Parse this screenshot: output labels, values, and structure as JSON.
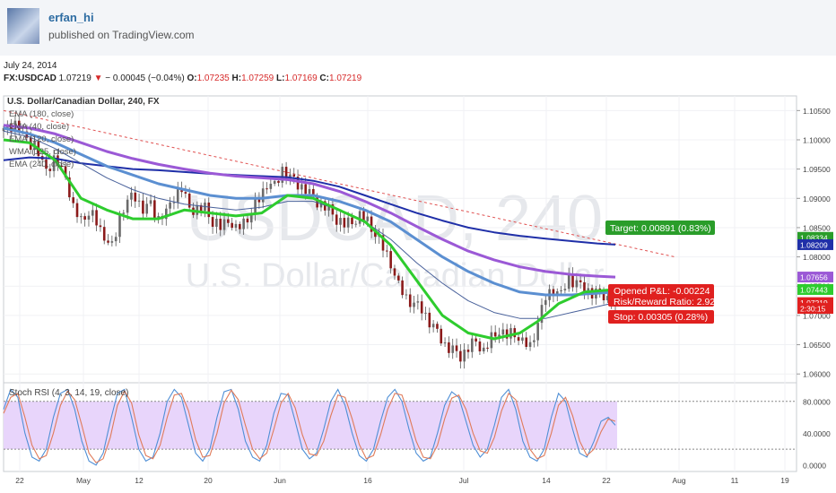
{
  "header": {
    "author": "erfan_hi",
    "published": "published on TradingView.com",
    "date": "July 24, 2014",
    "symbol": "FX:USDCAD",
    "price": "1.07219",
    "change": "− 0.00045 (−0.04%)",
    "open_label": "O:",
    "open": "1.07235",
    "high_label": "H:",
    "high": "1.07259",
    "low_label": "L:",
    "low": "1.07169",
    "close_label": "C:",
    "close": "1.07219"
  },
  "colors": {
    "green_ma": "#2ecc2e",
    "steel_ma": "#5b8fd1",
    "thin_ma": "#48609a",
    "purple_ma": "#9b59d6",
    "navy_ma": "#1f2fa8",
    "trend": "#e05050",
    "stoch_k": "#4f8fd6",
    "stoch_d": "#e07b5a",
    "stoch_band": "#e8d5fb",
    "target": "#2a9d2a",
    "stop": "#e0201f"
  },
  "chart_data": [
    {
      "type": "candlestick",
      "title": "U.S. Dollar/Canadian Dollar, 240, FX",
      "watermark_symbol": "USDCAD, 240",
      "watermark_name": "U.S. Dollar/Canadian Dollar",
      "legend": [
        "EMA (180, close)",
        "EMA (40, close)",
        "EMA (120, close)",
        "WMA (125, close)",
        "EMA (240, close)"
      ],
      "x_ticks": [
        "22",
        "May",
        "12",
        "20",
        "Jun",
        "16",
        "Jul",
        "14",
        "22",
        "Aug",
        "11",
        "19"
      ],
      "y_ticks": [
        "1.10500",
        "1.10000",
        "1.09500",
        "1.09000",
        "1.08500",
        "1.08000",
        "1.07500",
        "1.07000",
        "1.06500",
        "1.06000"
      ],
      "ylim": [
        1.0585,
        1.1075
      ],
      "price_tags": [
        {
          "label": "1.08334",
          "value": 1.08334,
          "color": "#2a9d2a"
        },
        {
          "label": "1.08209",
          "value": 1.08209,
          "color": "#1f2fa8"
        },
        {
          "label": "1.07656",
          "value": 1.07656,
          "color": "#9b59d6"
        },
        {
          "label": "1.07443",
          "value": 1.07443,
          "color": "#2ecc2e"
        },
        {
          "label": "1.07219",
          "value": 1.07219,
          "color": "#e0201f"
        },
        {
          "label": "2:30:15",
          "value": 1.0712,
          "color": "#e0201f"
        }
      ],
      "position": {
        "target_label": "Target: 0.00891 (0.83%)",
        "pnl_label": "Opened P&L: -0.00224",
        "ratio_label": "Risk/Reward Ratio: 2.92",
        "stop_label": "Stop: 0.00305 (0.28%)"
      },
      "close_path": [
        [
          0,
          1.1015
        ],
        [
          4,
          1.103
        ],
        [
          8,
          1.1005
        ],
        [
          12,
          1.099
        ],
        [
          16,
          1.095
        ],
        [
          20,
          1.0965
        ],
        [
          24,
          1.094
        ],
        [
          27,
          1.088
        ],
        [
          30,
          1.0865
        ],
        [
          33,
          1.0875
        ],
        [
          36,
          1.086
        ],
        [
          39,
          1.0835
        ],
        [
          42,
          1.0815
        ],
        [
          45,
          1.087
        ],
        [
          48,
          1.0895
        ],
        [
          51,
          1.0905
        ],
        [
          54,
          1.088
        ],
        [
          57,
          1.089
        ],
        [
          60,
          1.0865
        ],
        [
          63,
          1.0875
        ],
        [
          66,
          1.0905
        ],
        [
          69,
          1.0915
        ],
        [
          72,
          1.0885
        ],
        [
          75,
          1.088
        ],
        [
          78,
          1.0885
        ],
        [
          81,
          1.086
        ],
        [
          84,
          1.085
        ],
        [
          87,
          1.0865
        ],
        [
          90,
          1.0845
        ],
        [
          93,
          1.086
        ],
        [
          96,
          1.0875
        ],
        [
          99,
          1.09
        ],
        [
          102,
          1.0925
        ],
        [
          105,
          1.092
        ],
        [
          108,
          1.095
        ],
        [
          111,
          1.0935
        ],
        [
          114,
          1.0925
        ],
        [
          117,
          1.0915
        ],
        [
          120,
          1.09
        ],
        [
          123,
          1.089
        ],
        [
          126,
          1.088
        ],
        [
          129,
          1.0865
        ],
        [
          132,
          1.0855
        ],
        [
          135,
          1.086
        ],
        [
          138,
          1.087
        ],
        [
          141,
          1.086
        ],
        [
          144,
          1.084
        ],
        [
          147,
          1.0815
        ],
        [
          150,
          1.079
        ],
        [
          153,
          1.075
        ],
        [
          156,
          1.073
        ],
        [
          159,
          1.072
        ],
        [
          162,
          1.071
        ],
        [
          165,
          1.069
        ],
        [
          168,
          1.067
        ],
        [
          171,
          1.065
        ],
        [
          174,
          1.064
        ],
        [
          177,
          1.063
        ],
        [
          180,
          1.0645
        ],
        [
          183,
          1.0655
        ],
        [
          186,
          1.064
        ],
        [
          189,
          1.066
        ],
        [
          192,
          1.0675
        ],
        [
          195,
          1.0665
        ],
        [
          198,
          1.067
        ],
        [
          201,
          1.0655
        ],
        [
          204,
          1.0645
        ],
        [
          207,
          1.069
        ],
        [
          210,
          1.073
        ],
        [
          213,
          1.0745
        ],
        [
          216,
          1.0735
        ],
        [
          219,
          1.0765
        ],
        [
          222,
          1.0755
        ],
        [
          225,
          1.0745
        ],
        [
          228,
          1.074
        ],
        [
          231,
          1.0735
        ],
        [
          234,
          1.073
        ],
        [
          237,
          1.07219
        ]
      ],
      "ema40": [
        [
          0,
          1.1
        ],
        [
          10,
          1.0995
        ],
        [
          20,
          1.0965
        ],
        [
          30,
          1.09
        ],
        [
          40,
          1.088
        ],
        [
          50,
          1.0865
        ],
        [
          60,
          1.0865
        ],
        [
          70,
          1.088
        ],
        [
          80,
          1.0875
        ],
        [
          90,
          1.087
        ],
        [
          100,
          1.0875
        ],
        [
          110,
          1.0905
        ],
        [
          120,
          1.09
        ],
        [
          130,
          1.088
        ],
        [
          140,
          1.086
        ],
        [
          150,
          1.082
        ],
        [
          160,
          1.076
        ],
        [
          170,
          1.07
        ],
        [
          180,
          1.067
        ],
        [
          190,
          1.066
        ],
        [
          200,
          1.067
        ],
        [
          207,
          1.069
        ],
        [
          215,
          1.072
        ],
        [
          225,
          1.074
        ],
        [
          237,
          1.07443
        ]
      ],
      "ema120": [
        [
          0,
          1.102
        ],
        [
          10,
          1.101
        ],
        [
          20,
          1.0995
        ],
        [
          30,
          1.0975
        ],
        [
          40,
          1.0955
        ],
        [
          50,
          1.094
        ],
        [
          60,
          1.0925
        ],
        [
          70,
          1.0915
        ],
        [
          80,
          1.0905
        ],
        [
          90,
          1.09
        ],
        [
          100,
          1.09
        ],
        [
          110,
          1.0905
        ],
        [
          120,
          1.0905
        ],
        [
          130,
          1.0895
        ],
        [
          140,
          1.088
        ],
        [
          150,
          1.086
        ],
        [
          160,
          1.083
        ],
        [
          170,
          1.08
        ],
        [
          180,
          1.0775
        ],
        [
          190,
          1.0755
        ],
        [
          200,
          1.074
        ],
        [
          210,
          1.0735
        ],
        [
          220,
          1.0735
        ],
        [
          230,
          1.0738
        ],
        [
          237,
          1.074
        ]
      ],
      "wma125": [
        [
          0,
          1.1015
        ],
        [
          10,
          1.1005
        ],
        [
          20,
          1.0985
        ],
        [
          30,
          1.096
        ],
        [
          40,
          1.0935
        ],
        [
          50,
          1.0915
        ],
        [
          60,
          1.09
        ],
        [
          70,
          1.089
        ],
        [
          80,
          1.0885
        ],
        [
          90,
          1.088
        ],
        [
          100,
          1.0885
        ],
        [
          110,
          1.0895
        ],
        [
          120,
          1.0895
        ],
        [
          130,
          1.088
        ],
        [
          140,
          1.086
        ],
        [
          150,
          1.083
        ],
        [
          160,
          1.079
        ],
        [
          170,
          1.0755
        ],
        [
          180,
          1.0725
        ],
        [
          190,
          1.0705
        ],
        [
          200,
          1.0695
        ],
        [
          210,
          1.0695
        ],
        [
          220,
          1.0705
        ],
        [
          230,
          1.0715
        ],
        [
          237,
          1.0722
        ]
      ],
      "ema180": [
        [
          0,
          1.1025
        ],
        [
          10,
          1.102
        ],
        [
          20,
          1.101
        ],
        [
          30,
          1.0995
        ],
        [
          40,
          1.098
        ],
        [
          50,
          1.0968
        ],
        [
          60,
          1.0958
        ],
        [
          70,
          1.095
        ],
        [
          80,
          1.0943
        ],
        [
          90,
          1.0938
        ],
        [
          100,
          1.0935
        ],
        [
          110,
          1.0932
        ],
        [
          120,
          1.0925
        ],
        [
          130,
          1.0912
        ],
        [
          140,
          1.0895
        ],
        [
          150,
          1.0875
        ],
        [
          160,
          1.0852
        ],
        [
          170,
          1.083
        ],
        [
          180,
          1.081
        ],
        [
          190,
          1.0795
        ],
        [
          200,
          1.0783
        ],
        [
          210,
          1.0775
        ],
        [
          220,
          1.077
        ],
        [
          230,
          1.0767
        ],
        [
          237,
          1.07656
        ]
      ],
      "ema240": [
        [
          0,
          1.0965
        ],
        [
          10,
          1.097
        ],
        [
          20,
          1.0968
        ],
        [
          30,
          1.096
        ],
        [
          40,
          1.0955
        ],
        [
          50,
          1.095
        ],
        [
          60,
          1.0948
        ],
        [
          70,
          1.0945
        ],
        [
          80,
          1.0942
        ],
        [
          90,
          1.094
        ],
        [
          100,
          1.0938
        ],
        [
          110,
          1.0936
        ],
        [
          120,
          1.093
        ],
        [
          130,
          1.092
        ],
        [
          140,
          1.0905
        ],
        [
          150,
          1.089
        ],
        [
          160,
          1.0875
        ],
        [
          170,
          1.0862
        ],
        [
          180,
          1.085
        ],
        [
          190,
          1.0842
        ],
        [
          200,
          1.0836
        ],
        [
          210,
          1.0831
        ],
        [
          220,
          1.0827
        ],
        [
          230,
          1.0823
        ],
        [
          237,
          1.08209
        ]
      ],
      "trendline": [
        [
          0,
          1.105
        ],
        [
          260,
          1.08
        ]
      ]
    },
    {
      "type": "line",
      "title": "Stoch RSI (4, 3, 14, 19, close)",
      "y_ticks": [
        "80.0000",
        "40.0000",
        "0.0000"
      ],
      "ylim": [
        -8,
        100
      ],
      "band": [
        20,
        80
      ],
      "series": [
        {
          "name": "K",
          "values": [
            70,
            95,
            85,
            40,
            10,
            5,
            20,
            60,
            90,
            95,
            70,
            30,
            5,
            0,
            15,
            55,
            90,
            95,
            60,
            20,
            5,
            10,
            40,
            80,
            95,
            85,
            50,
            15,
            5,
            20,
            60,
            92,
            95,
            70,
            30,
            10,
            5,
            25,
            65,
            90,
            88,
            55,
            20,
            8,
            15,
            45,
            80,
            95,
            75,
            40,
            12,
            5,
            20,
            55,
            85,
            95,
            80,
            45,
            15,
            5,
            10,
            40,
            75,
            92,
            85,
            55,
            25,
            10,
            20,
            50,
            85,
            95,
            70,
            30,
            10,
            5,
            20,
            60,
            90,
            80,
            45,
            15,
            10,
            30,
            55,
            60,
            50
          ]
        },
        {
          "name": "D",
          "values": [
            65,
            85,
            90,
            60,
            25,
            8,
            12,
            40,
            75,
            93,
            82,
            50,
            15,
            3,
            8,
            35,
            75,
            93,
            78,
            38,
            12,
            8,
            25,
            60,
            88,
            90,
            68,
            32,
            10,
            12,
            40,
            78,
            94,
            82,
            50,
            20,
            8,
            15,
            45,
            78,
            90,
            72,
            38,
            14,
            12,
            30,
            62,
            88,
            85,
            58,
            26,
            8,
            12,
            38,
            70,
            90,
            88,
            62,
            30,
            10,
            8,
            25,
            58,
            84,
            88,
            70,
            40,
            18,
            15,
            35,
            68,
            90,
            82,
            50,
            20,
            8,
            12,
            40,
            75,
            85,
            62,
            30,
            12,
            20,
            42,
            58,
            55
          ]
        }
      ]
    }
  ]
}
